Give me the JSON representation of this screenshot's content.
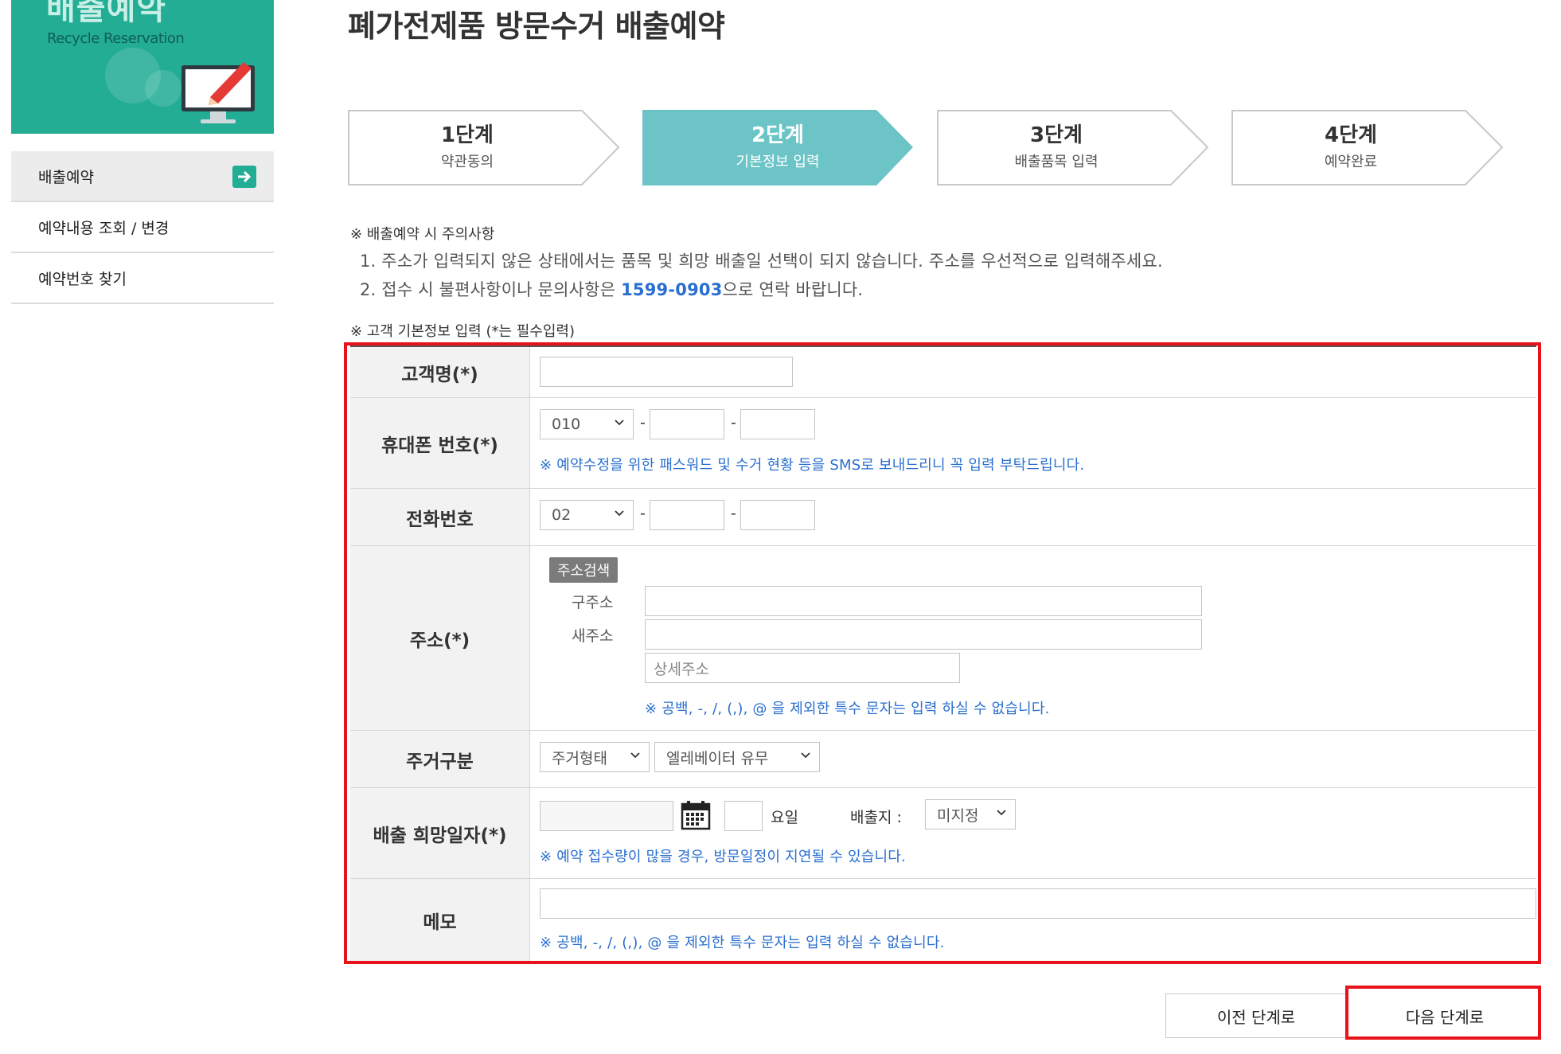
{
  "sidebar": {
    "banner_title": "배출예약",
    "banner_subtitle": "Recycle Reservation",
    "items": [
      {
        "label": "배출예약",
        "active": true
      },
      {
        "label": "예약내용 조회 / 변경",
        "active": false
      },
      {
        "label": "예약번호 찾기",
        "active": false
      }
    ]
  },
  "page_title": "폐가전제품 방문수거 배출예약",
  "steps": [
    {
      "num": "1단계",
      "desc": "약관동의"
    },
    {
      "num": "2단계",
      "desc": "기본정보 입력"
    },
    {
      "num": "3단계",
      "desc": "배출품목 입력"
    },
    {
      "num": "4단계",
      "desc": "예약완료"
    }
  ],
  "notice": {
    "head": "※ 배출예약 시 주의사항",
    "line1": "1. 주소가 입력되지 않은 상태에서는 품목 및 희망 배출일 선택이 되지 않습니다. 주소를 우선적으로 입력해주세요.",
    "line2_prefix": "2. 접수 시 불편사항이나 문의사항은 ",
    "line2_phone": "1599-0903",
    "line2_suffix": "으로 연락 바랍니다."
  },
  "section_label": "※ 고객 기본정보 입력 (*는 필수입력)",
  "form": {
    "name": {
      "label": "고객명(*)",
      "value": ""
    },
    "mobile": {
      "label": "휴대폰 번호(*)",
      "prefix": "010",
      "help": "※ 예약수정을 위한 패스워드 및 수거 현황 등을 SMS로 보내드리니 꼭 입력 부탁드립니다."
    },
    "phone": {
      "label": "전화번호",
      "prefix": "02"
    },
    "address": {
      "label": "주소(*)",
      "search_button": "주소검색",
      "old_label": "구주소",
      "new_label": "새주소",
      "detail_placeholder": "상세주소",
      "help": "※ 공백, -, /, (,), @ 을 제외한 특수 문자는 입력 하실 수 없습니다."
    },
    "residence": {
      "label": "주거구분",
      "type": "주거형태",
      "elevator": "엘레베이터 유무"
    },
    "date": {
      "label": "배출 희망일자(*)",
      "weekday_suffix": "요일",
      "place_label": "배출지 :",
      "place_value": "미지정",
      "help": "※ 예약 접수량이 많을 경우, 방문일정이 지연될 수 있습니다."
    },
    "memo": {
      "label": "메모",
      "help": "※ 공백, -, /, (,), @ 을 제외한 특수 문자는 입력 하실 수 없습니다."
    }
  },
  "buttons": {
    "prev": "이전 단계로",
    "next": "다음 단계로"
  },
  "colors": {
    "accent": "#23ad95",
    "step_active": "#6cc4c6",
    "highlight": "#e8121a",
    "link": "#2a6fcf"
  }
}
